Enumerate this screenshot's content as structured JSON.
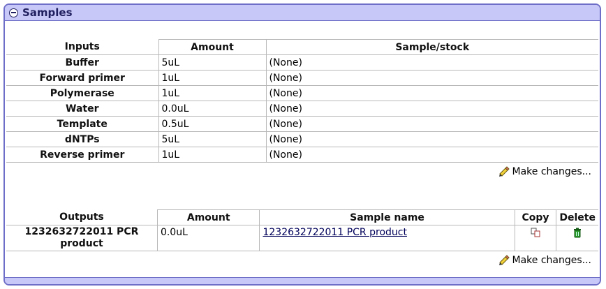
{
  "panel": {
    "title": "Samples"
  },
  "inputs": {
    "heading": "Inputs",
    "columns": {
      "amount": "Amount",
      "sample": "Sample/stock"
    },
    "rows": [
      {
        "name": "Buffer",
        "amount": "5uL",
        "sample": "(None)"
      },
      {
        "name": "Forward primer",
        "amount": "1uL",
        "sample": "(None)"
      },
      {
        "name": "Polymerase",
        "amount": "1uL",
        "sample": "(None)"
      },
      {
        "name": "Water",
        "amount": "0.0uL",
        "sample": "(None)"
      },
      {
        "name": "Template",
        "amount": "0.5uL",
        "sample": "(None)"
      },
      {
        "name": "dNTPs",
        "amount": "5uL",
        "sample": "(None)"
      },
      {
        "name": "Reverse primer",
        "amount": "1uL",
        "sample": "(None)"
      }
    ],
    "make_changes": "Make changes..."
  },
  "outputs": {
    "heading": "Outputs",
    "columns": {
      "amount": "Amount",
      "sample_name": "Sample name",
      "copy": "Copy",
      "delete": "Delete"
    },
    "rows": [
      {
        "name": "1232632722011 PCR product",
        "amount": "0.0uL",
        "sample_name": "1232632722011 PCR product"
      }
    ],
    "make_changes": "Make changes..."
  },
  "icons": {
    "collapse": "minus-circle-icon",
    "edit": "pencil-icon",
    "copy": "copy-icon",
    "delete": "trash-icon"
  },
  "colors": {
    "header_bg": "#c8c8f8",
    "border": "#6e6ec8",
    "link": "#00005a"
  }
}
